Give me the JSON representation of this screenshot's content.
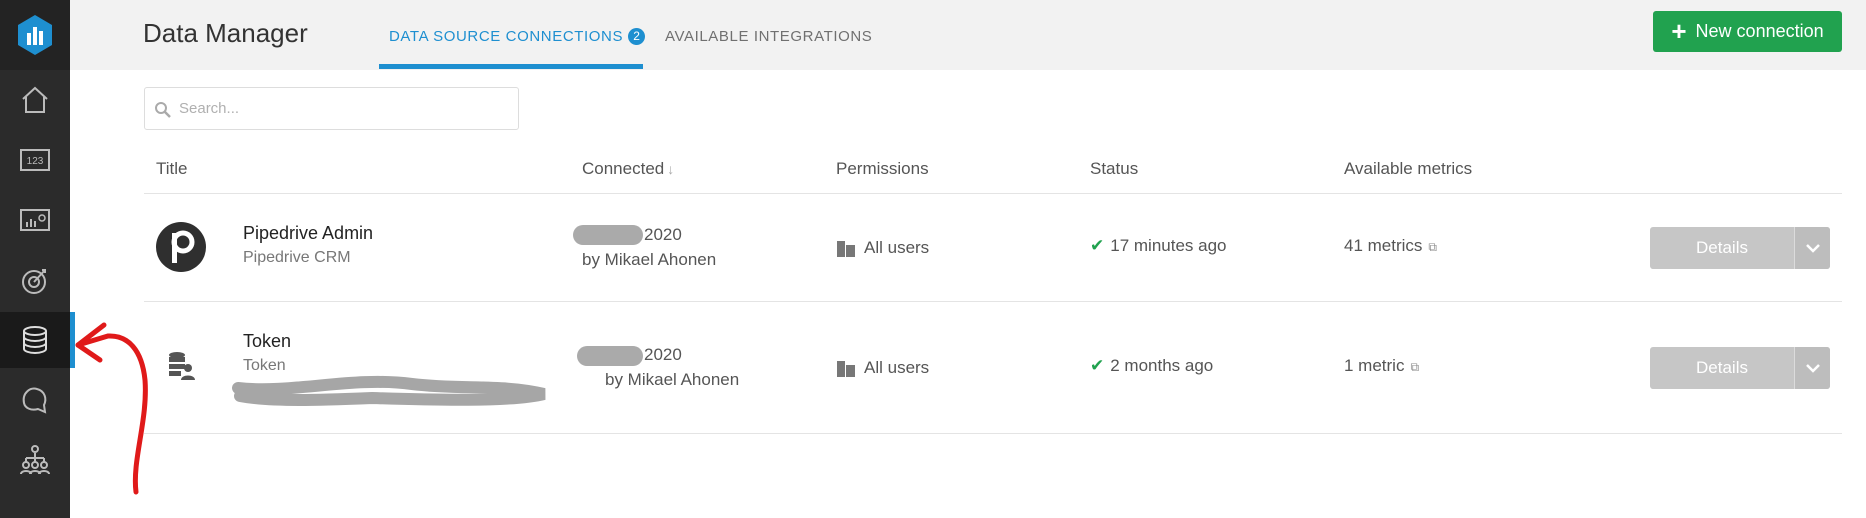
{
  "app": {
    "title": "Data Manager"
  },
  "header": {
    "tabs": [
      {
        "label": "DATA SOURCE CONNECTIONS",
        "badge": "2",
        "active": true
      },
      {
        "label": "AVAILABLE INTEGRATIONS",
        "active": false
      }
    ],
    "new_button": {
      "icon": "plus-icon",
      "label": "New connection"
    }
  },
  "sidebar": {
    "items": [
      {
        "icon": "home-icon"
      },
      {
        "icon": "number-widget-icon"
      },
      {
        "icon": "dashboard-icon"
      },
      {
        "icon": "goal-target-icon"
      },
      {
        "icon": "database-icon",
        "active": true
      },
      {
        "icon": "notifications-icon"
      },
      {
        "icon": "team-hierarchy-icon"
      }
    ]
  },
  "search": {
    "placeholder": "Search..."
  },
  "table": {
    "columns": [
      "Title",
      "Connected",
      "Permissions",
      "Status",
      "Available metrics"
    ],
    "rows": [
      {
        "title": "Pipedrive Admin",
        "subtitle": "Pipedrive CRM",
        "connected_date": "2020",
        "connected_by": "by Mikael Ahonen",
        "permissions": "All users",
        "status": "17 minutes ago",
        "metrics": "41 metrics",
        "action": "Details"
      },
      {
        "title": "Token",
        "subtitle": "Token",
        "connected_date": "2020",
        "connected_by": "by Mikael Ahonen",
        "permissions": "All users",
        "status": "2 months ago",
        "metrics": "1 metric",
        "action": "Details"
      }
    ]
  },
  "colors": {
    "accent": "#1e8fd0",
    "primary_button": "#21a24f",
    "sidebar_bg": "#2b2b2b",
    "annotation": "#e01a1a"
  }
}
